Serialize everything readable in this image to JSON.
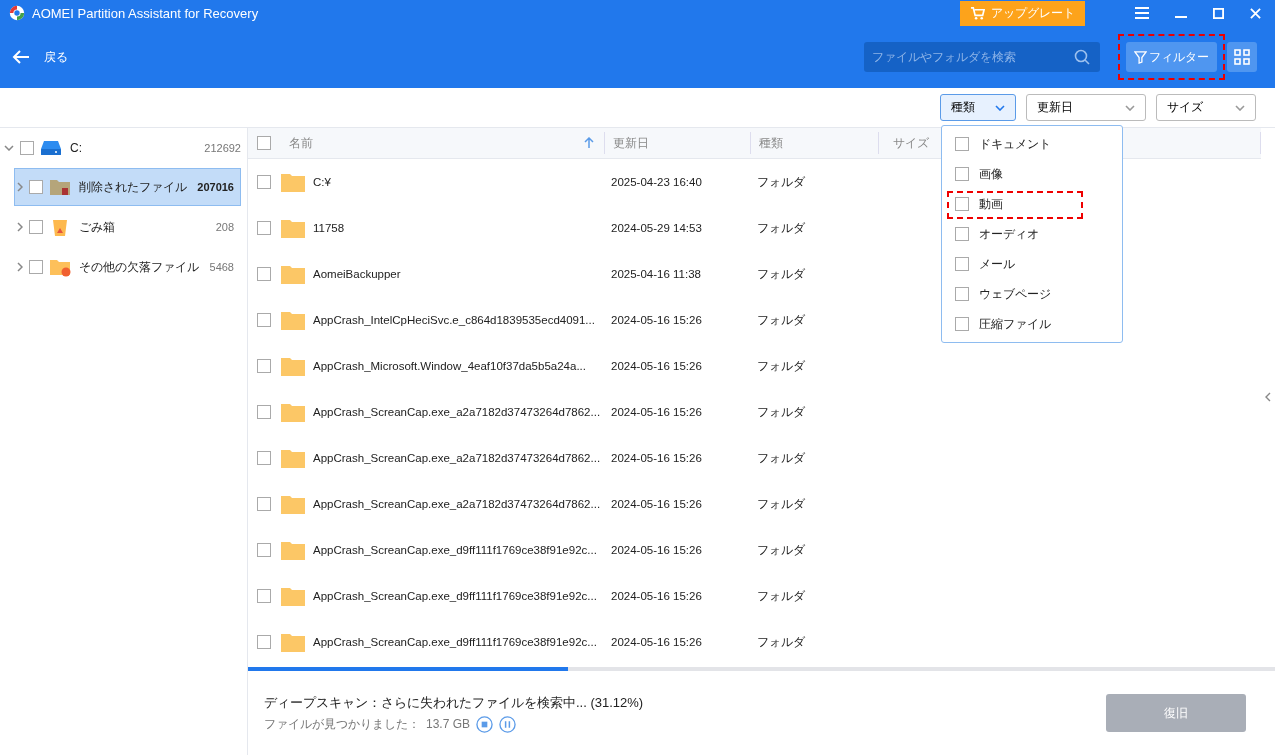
{
  "window": {
    "title": "AOMEI Partition Assistant for Recovery",
    "upgrade_button": "アップグレート"
  },
  "toolbar": {
    "back": "戻る",
    "search": {
      "placeholder": "ファイルやフォルダを検索"
    },
    "filter_button": {
      "label": "フィルター",
      "highlighted": true
    }
  },
  "filters": [
    {
      "label": "種類",
      "open": true
    },
    {
      "label": "更新日",
      "open": false
    },
    {
      "label": "サイズ",
      "open": false
    }
  ],
  "type_menu": [
    {
      "label": "ドキュメント",
      "checked": false,
      "highlighted": false
    },
    {
      "label": "画像",
      "checked": false,
      "highlighted": false
    },
    {
      "label": "動画",
      "checked": false,
      "highlighted": true
    },
    {
      "label": "オーディオ",
      "checked": false,
      "highlighted": false
    },
    {
      "label": "メール",
      "checked": false,
      "highlighted": false
    },
    {
      "label": "ウェブページ",
      "checked": false,
      "highlighted": false
    },
    {
      "label": "圧縮ファイル",
      "checked": false,
      "highlighted": false
    }
  ],
  "sidebar": {
    "drive": {
      "label": "C:",
      "count": "212692",
      "expanded": true,
      "checked": false
    },
    "items": [
      {
        "label": "削除されたファイル",
        "count": "207016",
        "kind": "deleted",
        "selected": true,
        "checked": false
      },
      {
        "label": "ごみ箱",
        "count": "208",
        "kind": "recycle",
        "selected": false,
        "checked": false
      },
      {
        "label": "その他の欠落ファイル",
        "count": "5468",
        "kind": "other",
        "selected": false,
        "checked": false
      }
    ]
  },
  "table": {
    "select_all_checked": false,
    "columns": [
      "名前",
      "更新日",
      "種類",
      "サイズ"
    ],
    "rows": [
      {
        "name": "C:¥",
        "date": "2025-04-23 16:40",
        "type": "フォルダ",
        "checked": false
      },
      {
        "name": "11758",
        "date": "2024-05-29 14:53",
        "type": "フォルダ",
        "checked": false
      },
      {
        "name": "AomeiBackupper",
        "date": "2025-04-16 11:38",
        "type": "フォルダ",
        "checked": false
      },
      {
        "name": "AppCrash_IntelCpHeciSvc.e_c864d1839535ecd4091...",
        "date": "2024-05-16 15:26",
        "type": "フォルダ",
        "checked": false
      },
      {
        "name": "AppCrash_Microsoft.Window_4eaf10f37da5b5a24a...",
        "date": "2024-05-16 15:26",
        "type": "フォルダ",
        "checked": false
      },
      {
        "name": "AppCrash_ScreanCap.exe_a2a7182d37473264d7862...",
        "date": "2024-05-16 15:26",
        "type": "フォルダ",
        "checked": false
      },
      {
        "name": "AppCrash_ScreanCap.exe_a2a7182d37473264d7862...",
        "date": "2024-05-16 15:26",
        "type": "フォルダ",
        "checked": false
      },
      {
        "name": "AppCrash_ScreanCap.exe_a2a7182d37473264d7862...",
        "date": "2024-05-16 15:26",
        "type": "フォルダ",
        "checked": false
      },
      {
        "name": "AppCrash_ScreanCap.exe_d9ff111f1769ce38f91e92c...",
        "date": "2024-05-16 15:26",
        "type": "フォルダ",
        "checked": false
      },
      {
        "name": "AppCrash_ScreanCap.exe_d9ff111f1769ce38f91e92c...",
        "date": "2024-05-16 15:26",
        "type": "フォルダ",
        "checked": false
      },
      {
        "name": "AppCrash_ScreanCap.exe_d9ff111f1769ce38f91e92c...",
        "date": "2024-05-16 15:26",
        "type": "フォルダ",
        "checked": false
      }
    ]
  },
  "status": {
    "level": 0.3112,
    "message": "ディープスキャン：さらに失われたファイルを検索中... (31.12%)",
    "found_label": "ファイルが見つかりました：",
    "found_size": "13.7 GB",
    "recover_button": {
      "label": "復旧",
      "disabled": true
    }
  }
}
